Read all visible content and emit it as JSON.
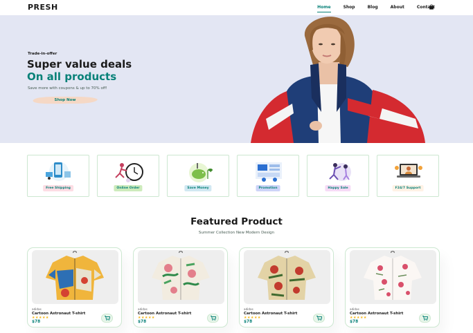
{
  "header": {
    "logo": "PRESH",
    "nav": [
      "Home",
      "Shop",
      "Blog",
      "About",
      "Contact"
    ],
    "active_nav": "Home",
    "cart_icon": "bag-icon"
  },
  "hero": {
    "kicker": "Trade-in-offer",
    "title_line1": "Super value deals",
    "title_line2": "On all products",
    "subtitle": "Save more with coupons & up to 70% off!",
    "button": "Shop Now"
  },
  "features": [
    {
      "label": "Free Shipping",
      "icon": "phone-shipping-illustration",
      "tag_color": "#fddde4"
    },
    {
      "label": "Online Order",
      "icon": "clock-runner-illustration",
      "tag_color": "#cdebbc"
    },
    {
      "label": "Save Money",
      "icon": "piggy-bank-illustration",
      "tag_color": "#d1e8f2"
    },
    {
      "label": "Promotion",
      "icon": "promotion-board-illustration",
      "tag_color": "#cdd4f8"
    },
    {
      "label": "Happy Sale",
      "icon": "happy-sale-illustration",
      "tag_color": "#f6dbf6"
    },
    {
      "label": "F24/7 Support",
      "icon": "support-laptop-illustration",
      "tag_color": "#fff2e5"
    }
  ],
  "featured": {
    "title": "Featured Product",
    "subtitle": "Summer Collection New Modern Design"
  },
  "products": [
    {
      "brand": "adidas",
      "name": "Cartoon Astronaut T-shirt",
      "stars": "★★★★★",
      "price": "$78"
    },
    {
      "brand": "adidas",
      "name": "Cartoon Astronaut T-shirt",
      "stars": "★★★★★",
      "price": "$78"
    },
    {
      "brand": "adidas",
      "name": "Cartoon Astronaut T-shirt",
      "stars": "★★★★★",
      "price": "$78"
    },
    {
      "brand": "adidas",
      "name": "Cartoon Astronaut T-shirt",
      "stars": "★★★★★",
      "price": "$78"
    }
  ],
  "colors": {
    "accent": "#088178",
    "hero_bg": "#e3e6f3",
    "star": "#f3b519"
  }
}
